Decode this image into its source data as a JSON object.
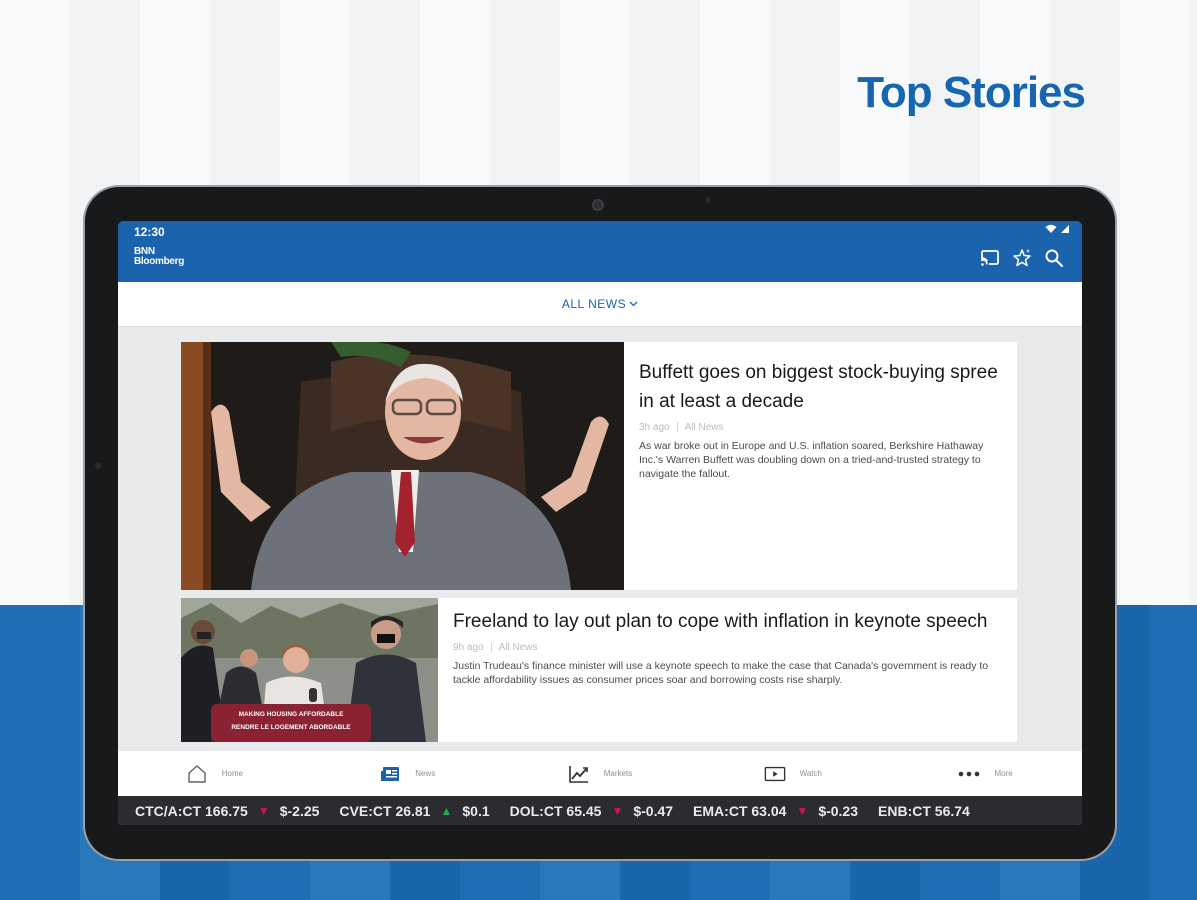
{
  "promo": {
    "headline": "Top Stories"
  },
  "status": {
    "time": "12:30"
  },
  "app": {
    "logo_line1": "BNN",
    "logo_line2": "Bloomberg",
    "filter_label": "ALL NEWS",
    "icons": [
      "cast-icon",
      "sparkle-star-icon",
      "search-icon"
    ]
  },
  "stories": [
    {
      "title": "Buffett goes on biggest stock-buying spree in at least a decade",
      "time": "3h ago",
      "category": "All News",
      "summary": "As war broke out in Europe and U.S. inflation soared, Berkshire Hathaway Inc.'s Warren Buffett was doubling down on a tried-and-trusted strategy to navigate the fallout."
    },
    {
      "title": "Freeland to lay out plan to cope with inflation in keynote speech",
      "time": "9h ago",
      "category": "All News",
      "summary": "Justin Trudeau's finance minister will use a keynote speech to make the case that Canada's government is ready to tackle affordability issues as consumer prices soar and borrowing costs rise sharply.",
      "image_sign_line1": "MAKING HOUSING AFFORDABLE",
      "image_sign_line2": "RENDRE LE LOGEMENT ABORDABLE"
    }
  ],
  "nav": [
    {
      "label": "Home",
      "icon": "home-icon"
    },
    {
      "label": "News",
      "icon": "news-icon"
    },
    {
      "label": "Markets",
      "icon": "markets-icon"
    },
    {
      "label": "Watch",
      "icon": "watch-icon"
    },
    {
      "label": "More",
      "icon": "more-icon"
    }
  ],
  "ticker": [
    {
      "symbol": "CTC/A:CT",
      "price": "166.75",
      "change": "$-2.25",
      "direction": "down"
    },
    {
      "symbol": "CVE:CT",
      "price": "26.81",
      "change": "$0.1",
      "direction": "up"
    },
    {
      "symbol": "DOL:CT",
      "price": "65.45",
      "change": "$-0.47",
      "direction": "down"
    },
    {
      "symbol": "EMA:CT",
      "price": "63.04",
      "change": "$-0.23",
      "direction": "down"
    },
    {
      "symbol": "ENB:CT",
      "price": "56.74",
      "change": "",
      "direction": ""
    }
  ],
  "colors": {
    "brand": "#1b63ad",
    "down": "#c8174b",
    "up": "#26a844"
  }
}
